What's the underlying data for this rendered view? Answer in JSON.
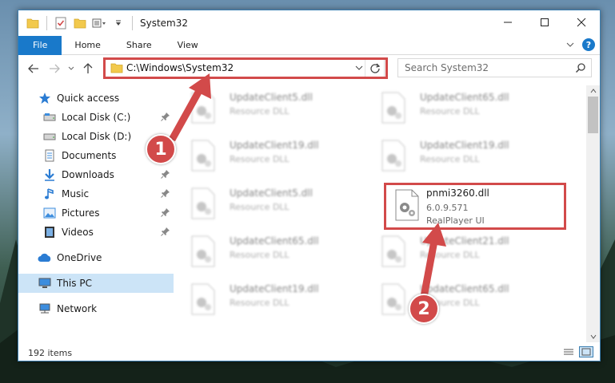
{
  "title_bar": {
    "title": "System32",
    "icons": [
      "folder-icon",
      "properties-check-icon",
      "new-folder-icon",
      "view-options-icon"
    ]
  },
  "ribbon": {
    "tabs": [
      {
        "label": "File"
      },
      {
        "label": "Home"
      },
      {
        "label": "Share"
      },
      {
        "label": "View"
      }
    ],
    "help_label": "?"
  },
  "address_bar": {
    "path": "C:\\Windows\\System32"
  },
  "search": {
    "placeholder": "Search System32"
  },
  "nav_pane": {
    "items": [
      {
        "label": "Quick access",
        "icon": "star-icon"
      },
      {
        "label": "Local Disk (C:)",
        "icon": "drive-icon",
        "pinned": true
      },
      {
        "label": "Local Disk (D:)",
        "icon": "drive-icon"
      },
      {
        "label": "Documents",
        "icon": "documents-icon"
      },
      {
        "label": "Downloads",
        "icon": "download-icon",
        "pinned": true
      },
      {
        "label": "Music",
        "icon": "music-icon",
        "pinned": true
      },
      {
        "label": "Pictures",
        "icon": "pictures-icon",
        "pinned": true
      },
      {
        "label": "Videos",
        "icon": "videos-icon",
        "pinned": true
      },
      {
        "label": "OneDrive",
        "icon": "cloud-icon"
      },
      {
        "label": "This PC",
        "icon": "computer-icon",
        "selected": true
      },
      {
        "label": "Network",
        "icon": "network-icon"
      }
    ]
  },
  "files": [
    {
      "name": "UpdateClient5.dll",
      "desc": "Resource DLL"
    },
    {
      "name": "UpdateClient65.dll",
      "desc": "Resource DLL"
    },
    {
      "name": "UpdateClient19.dll",
      "desc": "Resource DLL"
    },
    {
      "name": "UpdateClient19.dll",
      "desc": "Resource DLL"
    },
    {
      "name": "UpdateClient5.dll",
      "desc": "Resource DLL"
    },
    {
      "name": "pnmi3260.dll",
      "version": "6.0.9.571",
      "desc": "RealPlayer UI",
      "highlighted": true
    },
    {
      "name": "UpdateClient65.dll",
      "desc": "Resource DLL"
    },
    {
      "name": "UpdateClient21.dll",
      "desc": "Resource DLL"
    },
    {
      "name": "UpdateClient19.dll",
      "desc": "Resource DLL"
    },
    {
      "name": "UpdateClient65.dll",
      "desc": "Resource DLL"
    }
  ],
  "status_bar": {
    "item_count": "192 items"
  },
  "annotations": {
    "step1": "1",
    "step2": "2",
    "color": "#d24a4a"
  },
  "colors": {
    "accent": "#1979ca",
    "selection": "#cce4f7"
  }
}
